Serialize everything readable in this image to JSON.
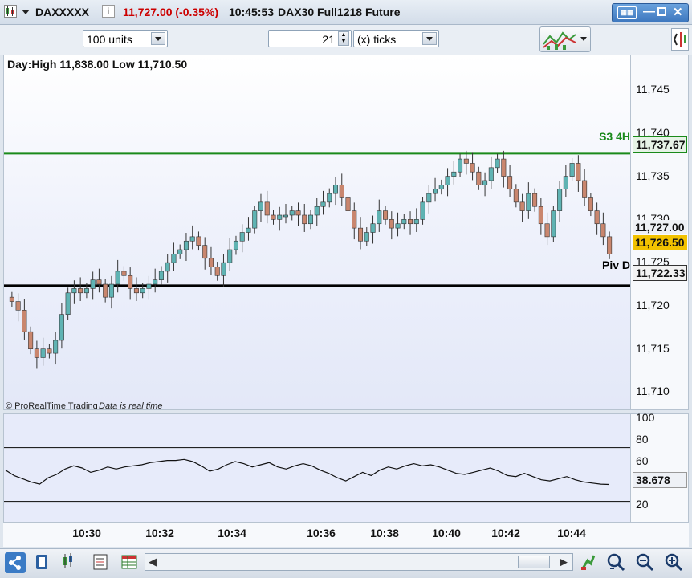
{
  "title_bar": {
    "symbol": "DAXXXXX",
    "price": "11,727.00 (-0.35%)",
    "time": "10:45:53",
    "instrument": "DAX30 Full1218 Future",
    "price_color": "#cc0000"
  },
  "toolbar": {
    "units_value": "100 units",
    "ticks_count": "21",
    "ticks_unit": "(x) ticks"
  },
  "chart": {
    "header": "Day:High 11,838.00 Low 11,710.50",
    "watermark": "© ProRealTime Trading",
    "realtime_note": "Data is real time",
    "line_s3": {
      "label": "S3 4H",
      "value": "11,737.67",
      "color": "#1a8a1a"
    },
    "line_piv": {
      "label": "Piv D",
      "value": "11,722.33",
      "color": "#000000"
    },
    "last_price": "11,727.00",
    "current_price": "11,726.50",
    "up_color": "#5fb3b3",
    "down_color": "#c9866e"
  },
  "chart_data": {
    "type": "candlestick",
    "ylim": [
      11708,
      11749
    ],
    "y_ticks": [
      "11,745",
      "11,740",
      "11,735",
      "11,730",
      "11,725",
      "11,720",
      "11,715",
      "11,710"
    ],
    "x_ticks": [
      "10:30",
      "10:32",
      "10:34",
      "10:36",
      "10:38",
      "10:40",
      "10:42",
      "10:44"
    ],
    "closes": [
      11720.5,
      11719.5,
      11717.0,
      11715.0,
      11714.0,
      11715.0,
      11714.5,
      11716.0,
      11719.0,
      11721.5,
      11722.0,
      11721.5,
      11722.0,
      11723.0,
      11722.5,
      11721.0,
      11722.5,
      11724.0,
      11723.5,
      11722.0,
      11721.5,
      11722.0,
      11722.5,
      11723.0,
      11724.0,
      11725.0,
      11726.0,
      11726.5,
      11727.5,
      11728.0,
      11727.0,
      11725.5,
      11724.5,
      11723.5,
      11725.0,
      11726.5,
      11727.5,
      11728.5,
      11729.0,
      11731.0,
      11732.0,
      11730.5,
      11730.0,
      11730.5,
      11730.5,
      11731.0,
      11730.5,
      11729.5,
      11730.5,
      11731.5,
      11732.0,
      11733.0,
      11734.0,
      11732.5,
      11731.0,
      11729.0,
      11727.5,
      11728.5,
      11729.5,
      11731.0,
      11730.0,
      11729.0,
      11729.5,
      11730.0,
      11729.5,
      11730.0,
      11732.0,
      11733.0,
      11733.5,
      11734.0,
      11735.0,
      11735.5,
      11737.0,
      11736.5,
      11735.5,
      11734.0,
      11734.5,
      11736.0,
      11737.0,
      11735.0,
      11733.5,
      11732.0,
      11731.0,
      11733.0,
      11731.5,
      11729.5,
      11728.0,
      11731.0,
      11733.5,
      11735.0,
      11736.5,
      11734.5,
      11732.5,
      11731.0,
      11729.5,
      11728.0,
      11726.0
    ],
    "rsi": {
      "levels": [
        100,
        80,
        60,
        40,
        20
      ],
      "upper_band": 73,
      "lower_band": 23,
      "current": "38.678",
      "values": [
        52,
        47,
        44,
        41,
        39,
        45,
        48,
        53,
        56,
        54,
        50,
        52,
        55,
        53,
        55,
        56,
        57,
        59,
        60,
        61,
        61,
        62,
        60,
        56,
        51,
        53,
        57,
        60,
        58,
        55,
        57,
        59,
        55,
        53,
        56,
        58,
        56,
        52,
        49,
        45,
        42,
        46,
        50,
        47,
        52,
        55,
        53,
        56,
        58,
        56,
        57,
        55,
        52,
        49,
        48,
        50,
        52,
        54,
        51,
        47,
        46,
        49,
        46,
        43,
        42,
        44,
        46,
        43,
        41,
        40,
        39,
        38.678
      ]
    }
  },
  "bottom_bar": {
    "icons": [
      "share-icon",
      "calendar-icon",
      "candlestick-icon",
      "report-icon",
      "table-icon"
    ],
    "scroll_left": "◀",
    "scroll_right": "▶",
    "zoom": [
      "drawing-tool-icon",
      "zoom-fit-icon",
      "zoom-out-icon",
      "zoom-in-icon"
    ]
  }
}
